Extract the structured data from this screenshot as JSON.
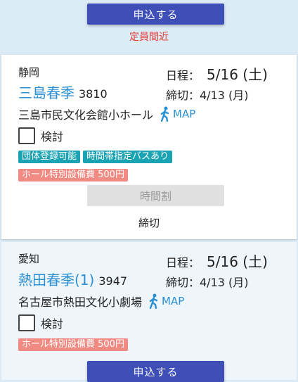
{
  "top": {
    "apply_label": "申込する",
    "status_note": "定員間近"
  },
  "cards": [
    {
      "prefecture": "静岡",
      "title": "三島春季",
      "code": "3810",
      "schedule_label": "日程：",
      "schedule_date": "5/16 (土)",
      "deadline": "締切：4/13 (月)",
      "venue": "三島市民文化会館小ホール",
      "map_label": "MAP",
      "checkbox_label": "検討",
      "tags": [
        "団体登録可能",
        "時間帯指定バスあり"
      ],
      "fee_tag": "ホール特別設備費 500円",
      "timetable_label": "時間割",
      "closed_label": "締切"
    },
    {
      "prefecture": "愛知",
      "title": "熱田春季(1)",
      "code": "3947",
      "schedule_label": "日程：",
      "schedule_date": "5/16 (土)",
      "deadline": "締切：4/13 (月)",
      "venue": "名古屋市熱田文化小劇場",
      "map_label": "MAP",
      "checkbox_label": "検討",
      "fee_tag": "ホール特別設備費 500円",
      "apply_label": "申込する"
    }
  ],
  "colors": {
    "accent_blue": "#2a8fd3",
    "button_indigo": "#3e4fb7",
    "tag_teal": "#1aa3b3",
    "tag_red": "#f08a82",
    "warning_red": "#e53935"
  }
}
